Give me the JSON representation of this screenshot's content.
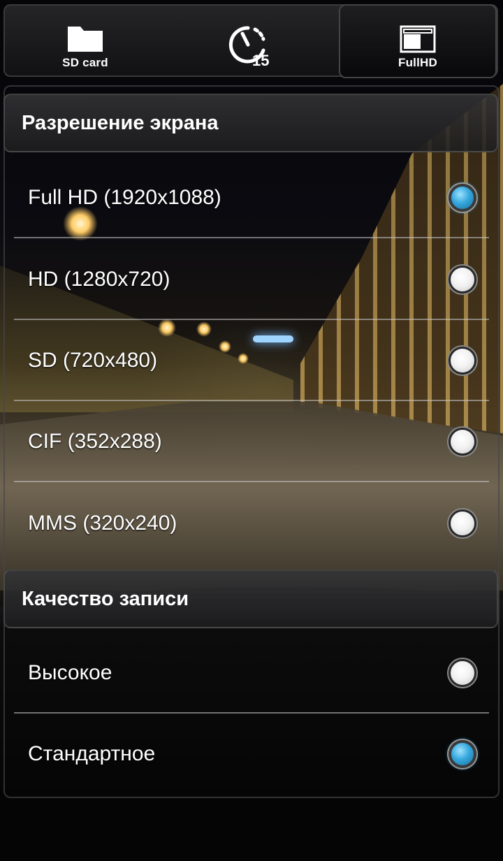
{
  "toolbar": {
    "buttons": [
      {
        "label": "SD card",
        "icon": "folder-icon",
        "selected": false
      },
      {
        "label": "",
        "icon": "timer-icon",
        "badge": "15",
        "selected": false
      },
      {
        "label": "FullHD",
        "icon": "resolution-frame-icon",
        "selected": true
      }
    ]
  },
  "sections": [
    {
      "title": "Разрешение экрана",
      "options": [
        {
          "label": "Full HD (1920x1088)",
          "checked": true
        },
        {
          "label": "HD (1280x720)",
          "checked": false
        },
        {
          "label": "SD (720x480)",
          "checked": false
        },
        {
          "label": "CIF (352x288)",
          "checked": false
        },
        {
          "label": "MMS (320x240)",
          "checked": false
        }
      ]
    },
    {
      "title": "Качество записи",
      "options": [
        {
          "label": "Высокое",
          "checked": false
        },
        {
          "label": "Стандартное",
          "checked": true
        }
      ]
    }
  ],
  "colors": {
    "radio_checked": "#35a8dd",
    "radio_unchecked": "#f2f2f2",
    "text": "#ffffff"
  }
}
